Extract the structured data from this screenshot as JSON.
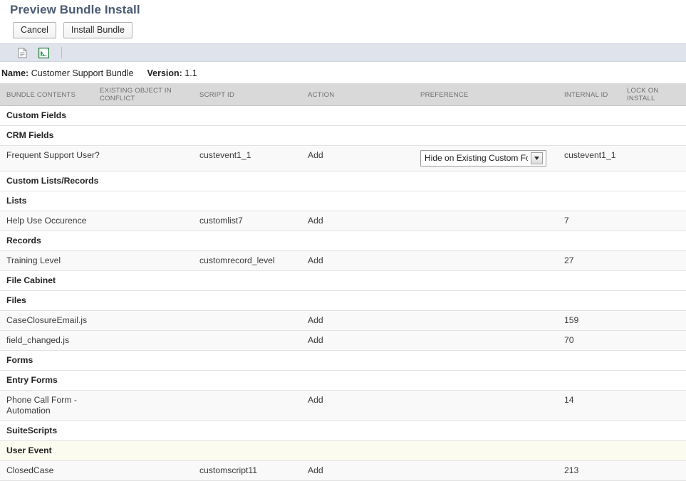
{
  "page": {
    "title": "Preview Bundle Install"
  },
  "actions": {
    "cancel_label": "Cancel",
    "install_label": "Install Bundle"
  },
  "toolbar": {
    "icons": [
      {
        "name": "document-icon",
        "title": "Print"
      },
      {
        "name": "excel-export-icon",
        "title": "Export to Excel"
      }
    ]
  },
  "bundle": {
    "name_label": "Name:",
    "name_value": "Customer Support Bundle",
    "version_label": "Version:",
    "version_value": "1.1"
  },
  "table": {
    "columns": [
      "BUNDLE CONTENTS",
      "EXISTING OBJECT IN CONFLICT",
      "SCRIPT ID",
      "ACTION",
      "PREFERENCE",
      "INTERNAL ID",
      "LOCK ON INSTALL"
    ],
    "rows": [
      {
        "kind": "section",
        "contents": "Custom Fields"
      },
      {
        "kind": "section",
        "contents": "CRM Fields"
      },
      {
        "kind": "data",
        "contents": "Frequent Support User?",
        "conflict": "",
        "script_id": "custevent1_1",
        "action": "Add",
        "preference": "Hide on Existing Custom Forms",
        "internal_id": "custevent1_1",
        "lock": ""
      },
      {
        "kind": "section",
        "contents": "Custom Lists/Records"
      },
      {
        "kind": "section",
        "contents": "Lists"
      },
      {
        "kind": "data",
        "contents": "Help Use Occurence",
        "conflict": "",
        "script_id": "customlist7",
        "action": "Add",
        "preference": "",
        "internal_id": "7",
        "lock": ""
      },
      {
        "kind": "section",
        "contents": "Records"
      },
      {
        "kind": "data",
        "contents": "Training Level",
        "conflict": "",
        "script_id": "customrecord_level",
        "action": "Add",
        "preference": "",
        "internal_id": "27",
        "lock": ""
      },
      {
        "kind": "section",
        "contents": "File Cabinet"
      },
      {
        "kind": "section",
        "contents": "Files"
      },
      {
        "kind": "data",
        "contents": "CaseClosureEmail.js",
        "conflict": "",
        "script_id": "",
        "action": "Add",
        "preference": "",
        "internal_id": "159",
        "lock": ""
      },
      {
        "kind": "data",
        "contents": "field_changed.js",
        "conflict": "",
        "script_id": "",
        "action": "Add",
        "preference": "",
        "internal_id": "70",
        "lock": ""
      },
      {
        "kind": "section",
        "contents": "Forms"
      },
      {
        "kind": "section",
        "contents": "Entry Forms"
      },
      {
        "kind": "data",
        "contents": "Phone Call Form - Automation",
        "conflict": "",
        "script_id": "",
        "action": "Add",
        "preference": "",
        "internal_id": "14",
        "lock": ""
      },
      {
        "kind": "section",
        "contents": "SuiteScripts"
      },
      {
        "kind": "section-highlight",
        "contents": "User Event"
      },
      {
        "kind": "data",
        "contents": "ClosedCase",
        "conflict": "",
        "script_id": "customscript11",
        "action": "Add",
        "preference": "",
        "internal_id": "213",
        "lock": ""
      }
    ]
  },
  "colors": {
    "title": "#4a5a72",
    "toolbar_bg": "#dfe3eb",
    "header_bg": "#d9d9d9",
    "row_alt": "#f9f9f9",
    "row_highlight": "#fbfbef",
    "excel_green": "#217a3c"
  }
}
